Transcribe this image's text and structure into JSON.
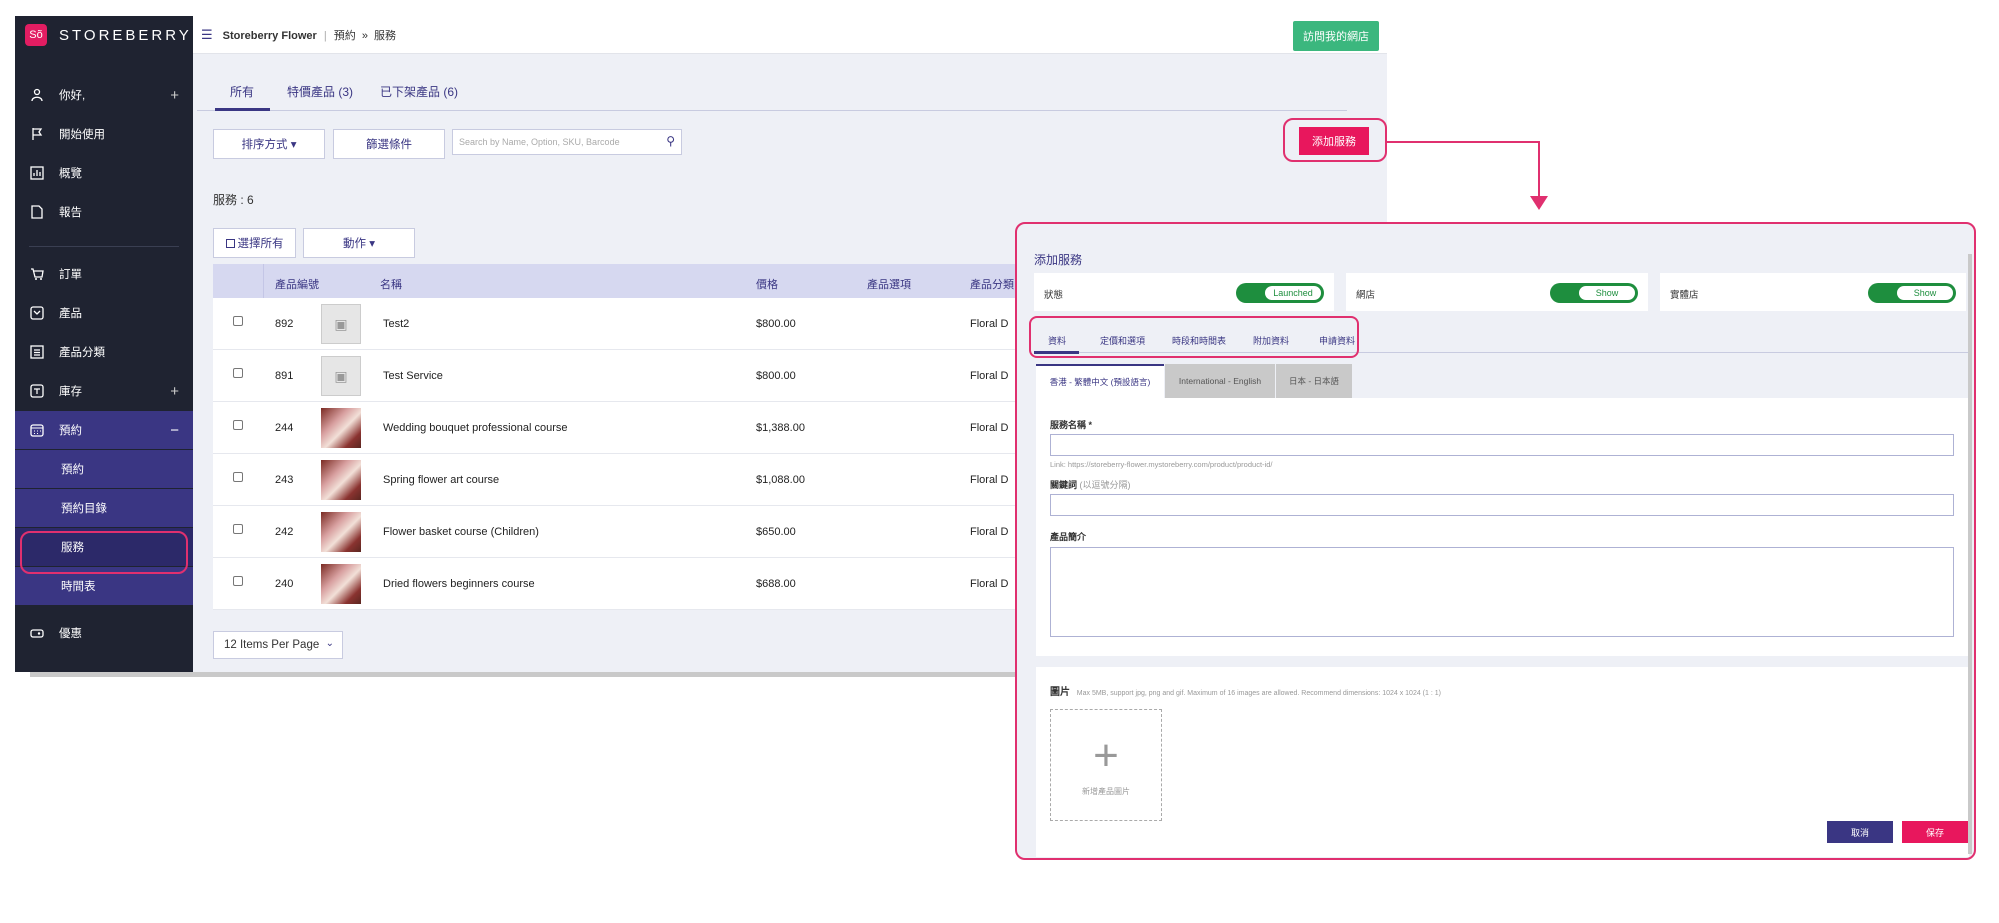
{
  "brand": {
    "name": "STOREBERRY",
    "logo_text": "Sõ"
  },
  "topbar": {
    "store": "Storeberry Flower",
    "crumb_sep": "|",
    "crumb_parent": "預約",
    "crumb_arrow": "»",
    "crumb_current": "服務",
    "visit_label": "訪問我的網店"
  },
  "sidebar": {
    "items": [
      {
        "label": "你好,",
        "icon": "user-icon",
        "plus": "+"
      },
      {
        "label": "開始使用",
        "icon": "flag-icon"
      },
      {
        "label": "概覽",
        "icon": "chart-icon"
      },
      {
        "label": "報告",
        "icon": "file-icon"
      },
      {
        "label": "訂單",
        "icon": "cart-icon"
      },
      {
        "label": "產品",
        "icon": "box-icon"
      },
      {
        "label": "產品分類",
        "icon": "list-icon"
      },
      {
        "label": "庫存",
        "icon": "inventory-icon",
        "plus": "+"
      },
      {
        "label": "預約",
        "icon": "calendar-icon",
        "minus": "−"
      },
      {
        "label": "優惠",
        "icon": "ticket-icon"
      }
    ],
    "subitems": [
      "預約",
      "預約目錄",
      "服務",
      "時間表"
    ]
  },
  "tabs": [
    "所有",
    "特價產品 (3)",
    "已下架產品 (6)"
  ],
  "toolbar": {
    "sort": "排序方式 ▾",
    "filter": "篩選條件",
    "search_placeholder": "Search by Name, Option, SKU, Barcode",
    "add": "添加服務"
  },
  "count": "服務 : 6",
  "actions": {
    "select_all": "選擇所有",
    "action": "動作 ▾"
  },
  "columns": [
    "產品編號",
    "名稱",
    "價格",
    "產品選項",
    "產品分類"
  ],
  "rows": [
    {
      "id": "892",
      "name": "Test2",
      "price": "$800.00",
      "category": "Floral D",
      "photo": false
    },
    {
      "id": "891",
      "name": "Test Service",
      "price": "$800.00",
      "category": "Floral D",
      "photo": false
    },
    {
      "id": "244",
      "name": "Wedding bouquet professional course",
      "price": "$1,388.00",
      "category": "Floral D",
      "photo": true
    },
    {
      "id": "243",
      "name": "Spring flower art course",
      "price": "$1,088.00",
      "category": "Floral D",
      "photo": true
    },
    {
      "id": "242",
      "name": "Flower basket course (Children)",
      "price": "$650.00",
      "category": "Floral D",
      "photo": true
    },
    {
      "id": "240",
      "name": "Dried flowers beginners course",
      "price": "$688.00",
      "category": "Floral D",
      "photo": true
    }
  ],
  "perpage": "12 Items Per Page",
  "modal": {
    "title": "添加服務",
    "switches": [
      {
        "label": "狀態",
        "value": "Launched"
      },
      {
        "label": "網店",
        "value": "Show"
      },
      {
        "label": "實體店",
        "value": "Show"
      }
    ],
    "tabs": [
      "資料",
      "定價和選項",
      "時段和時間表",
      "附加資料",
      "申請資料"
    ],
    "langs": [
      "香港 - 繁體中文 (預設語言)",
      "International - English",
      "日本 - 日本語"
    ],
    "name_label": "服務名稱 *",
    "link_hint": "Link: https://storeberry-flower.mystoreberry.com/product/product-id/",
    "keywords_label": "關鍵詞",
    "keywords_hint": "(以逗號分隔)",
    "intro_label": "產品簡介",
    "image_label": "圖片",
    "image_hint": "Max 5MB, support jpg, png and gif. Maximum of 16 images are allowed. Recommend dimensions: 1024 x 1024 (1 : 1)",
    "upload_text": "新增產品圖片",
    "cancel": "取消",
    "save": "保存"
  },
  "colors": {
    "accent": "#3a3683",
    "primary": "#e8175d",
    "green": "#3bb77e",
    "sidebar": "#1f2331",
    "highlight": "#e0306f"
  }
}
